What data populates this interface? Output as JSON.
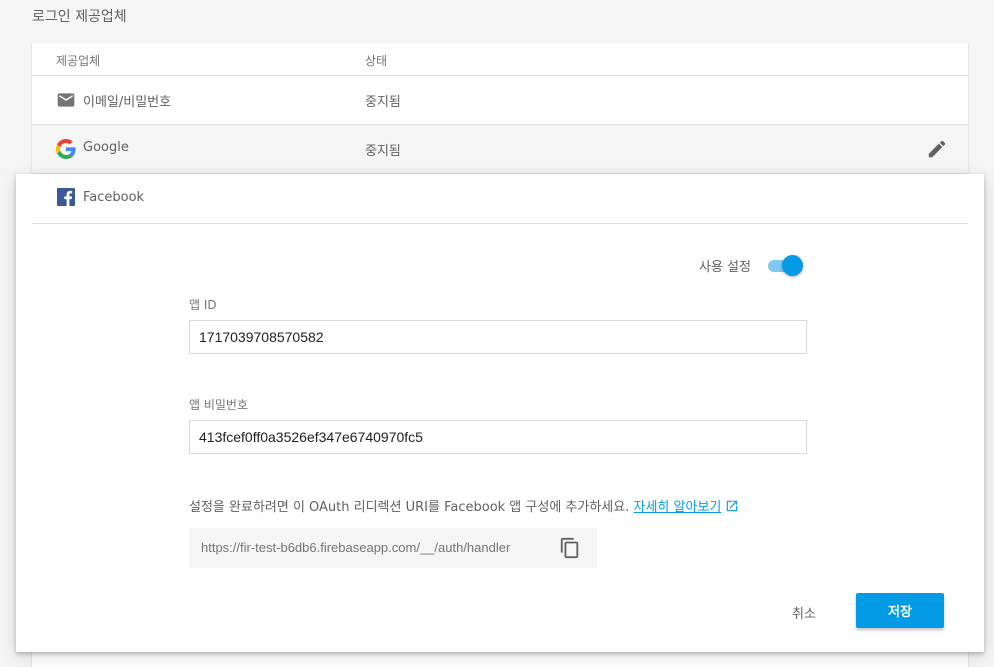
{
  "section_title": "로그인 제공업체",
  "table": {
    "header_provider": "제공업체",
    "header_status": "상태",
    "rows": [
      {
        "icon": "mail-icon",
        "name": "이메일/비밀번호",
        "status": "중지됨"
      },
      {
        "icon": "google-icon",
        "name": "Google",
        "status": "중지됨"
      }
    ]
  },
  "facebook_panel": {
    "icon": "facebook-icon",
    "name": "Facebook",
    "enable_label": "사용 설정",
    "enabled": true,
    "app_id_label": "앱 ID",
    "app_id_value": "1717039708570582",
    "app_secret_label": "앱 비밀번호",
    "app_secret_value": "413fcef0ff0a3526ef347e6740970fc5",
    "instruction": "설정을 완료하려면 이 OAuth 리디렉션 URI를 Facebook 앱 구성에 추가하세요.",
    "learn_more": "자세히 알아보기",
    "redirect_uri": "https://fir-test-b6db6.firebaseapp.com/__/auth/handler",
    "cancel_label": "취소",
    "save_label": "저장"
  },
  "colors": {
    "accent": "#039be5",
    "facebook": "#3b5998",
    "background": "#f5f5f5"
  }
}
